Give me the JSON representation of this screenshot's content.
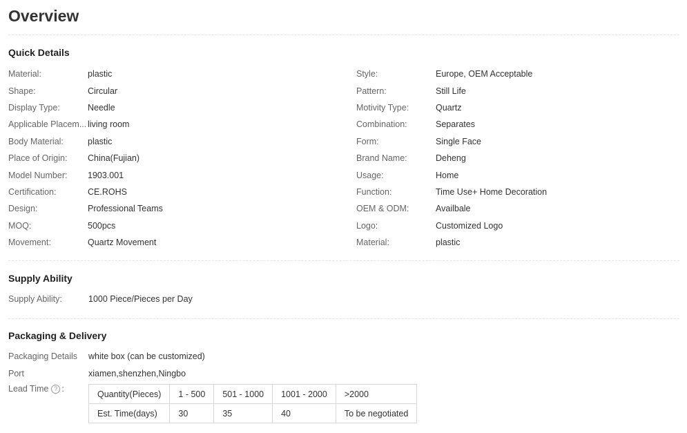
{
  "page_title": "Overview",
  "quick_details": {
    "title": "Quick Details",
    "left": [
      {
        "label": "Material:",
        "value": "plastic"
      },
      {
        "label": "Shape:",
        "value": "Circular"
      },
      {
        "label": "Display Type:",
        "value": "Needle"
      },
      {
        "label": "Applicable Placem...",
        "value": "living room"
      },
      {
        "label": "Body Material:",
        "value": "plastic"
      },
      {
        "label": "Place of Origin:",
        "value": "China(Fujian)"
      },
      {
        "label": "Model Number:",
        "value": "1903.001"
      },
      {
        "label": "Certification:",
        "value": "CE.ROHS"
      },
      {
        "label": "Design:",
        "value": "Professional Teams"
      },
      {
        "label": "MOQ:",
        "value": "500pcs"
      },
      {
        "label": "Movement:",
        "value": "Quartz Movement"
      }
    ],
    "right": [
      {
        "label": "Style:",
        "value": "Europe, OEM Acceptable"
      },
      {
        "label": "Pattern:",
        "value": "Still Life"
      },
      {
        "label": "Motivity Type:",
        "value": "Quartz"
      },
      {
        "label": "Combination:",
        "value": "Separates"
      },
      {
        "label": "Form:",
        "value": "Single Face"
      },
      {
        "label": "Brand Name:",
        "value": "Deheng"
      },
      {
        "label": "Usage:",
        "value": "Home"
      },
      {
        "label": "Function:",
        "value": "Time Use+ Home Decoration"
      },
      {
        "label": "OEM & ODM:",
        "value": "Availbale"
      },
      {
        "label": "Logo:",
        "value": "Customized Logo"
      },
      {
        "label": "Material:",
        "value": "plastic"
      }
    ]
  },
  "supply_ability": {
    "title": "Supply Ability",
    "label": "Supply Ability:",
    "value": "1000 Piece/Pieces per Day"
  },
  "packaging": {
    "title": "Packaging & Delivery",
    "details_label": "Packaging Details",
    "details_value": "white box (can be customized)",
    "port_label": "Port",
    "port_value": "xiamen,shenzhen,Ningbo",
    "lead_time_label": "Lead Time",
    "help_icon": "?",
    "lead_colon": ":",
    "lead_table": {
      "row1": [
        "Quantity(Pieces)",
        "1 - 500",
        "501 - 1000",
        "1001 - 2000",
        ">2000"
      ],
      "row2": [
        "Est. Time(days)",
        "30",
        "35",
        "40",
        "To be negotiated"
      ]
    }
  }
}
